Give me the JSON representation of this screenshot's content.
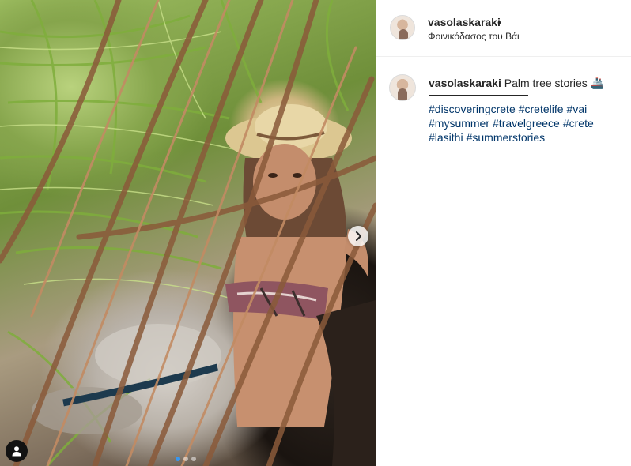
{
  "post": {
    "username": "vasolaskaraki",
    "separator": "•",
    "location": "Φοινικόδασος του Βάι"
  },
  "caption": {
    "username": "vasolaskaraki",
    "text": "Palm tree stories 🚢",
    "hashtags": [
      "#discoveringcrete",
      "#cretelife",
      "#vai",
      "#mysummer",
      "#travelgreece",
      "#crete",
      "#lasithi",
      "#summerstories"
    ]
  },
  "carousel": {
    "current_index": 1,
    "total": 3
  },
  "icons": {
    "next": "chevron-right-icon",
    "tags": "user-tag-icon"
  },
  "colors": {
    "hashtag": "#003569",
    "active_dot": "#3897f0"
  }
}
